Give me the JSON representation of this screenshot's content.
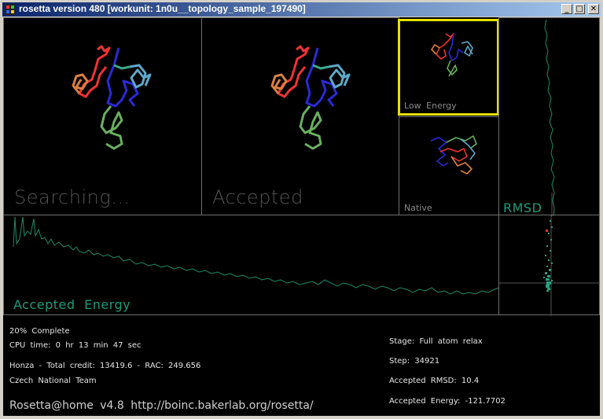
{
  "window": {
    "title": "rosetta version 480 [workunit: 1n0u__topology_sample_197490]",
    "minimize_symbol": "_",
    "maximize_symbol": "□",
    "close_symbol": "✕"
  },
  "panels": {
    "searching_label": "Searching...",
    "accepted_label": "Accepted",
    "low_energy_label": "Low  Energy",
    "native_label": "Native",
    "rmsd_label": "RMSD",
    "accepted_energy_label": "Accepted  Energy"
  },
  "status": {
    "percent_complete": "20% Complete",
    "cpu_time": "CPU time: 0 hr 13 min 47 sec",
    "credit_line": "Honza - Total credit: 13419.6 - RAC: 249.656",
    "team": "Czech National Team",
    "footer": "Rosetta@home  v4.8   http://boinc.bakerlab.org/rosetta/",
    "stage": "Stage: Full atom relax",
    "step": "Step: 34921",
    "accepted_rmsd": "Accepted RMSD: 10.4",
    "accepted_energy": "Accepted Energy: -121.7702"
  },
  "colors": {
    "plot_line": "#1e8a6a",
    "highlight": "#e8e000",
    "panel_border": "#6e6e6e"
  }
}
